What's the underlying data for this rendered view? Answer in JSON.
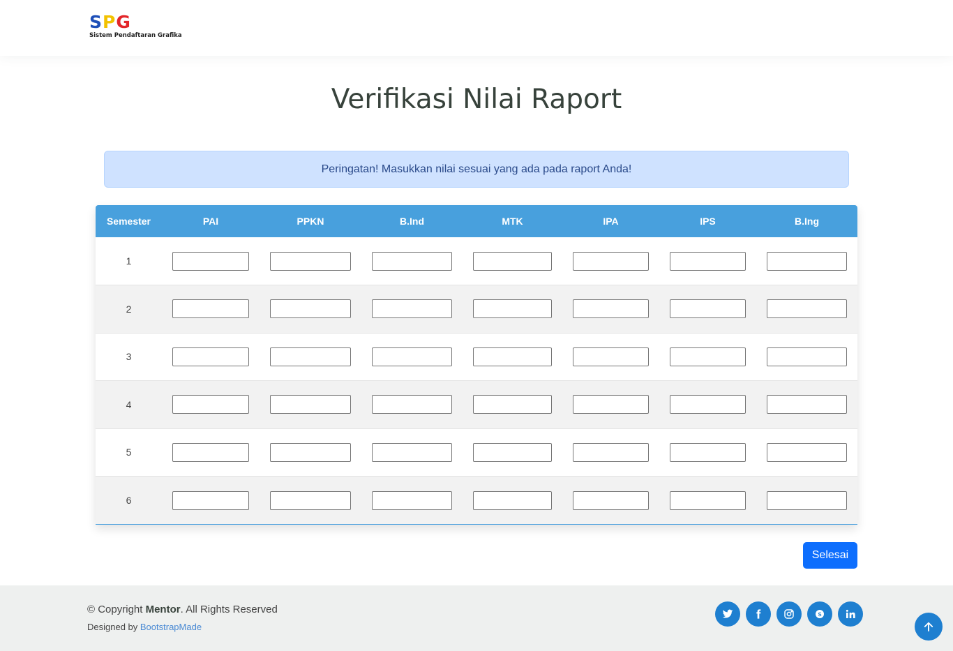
{
  "header": {
    "logo_letters": [
      "S",
      "P",
      "G"
    ],
    "logo_subtitle": "Sistem Pendaftaran Grafika"
  },
  "page": {
    "title": "Verifikasi Nilai Raport"
  },
  "alert": {
    "text": "Peringatan! Masukkan nilai sesuai yang ada pada raport Anda!"
  },
  "table": {
    "columns": [
      "Semester",
      "PAI",
      "PPKN",
      "B.Ind",
      "MTK",
      "IPA",
      "IPS",
      "B.Ing"
    ],
    "rows": [
      {
        "semester": "1",
        "values": [
          "",
          "",
          "",
          "",
          "",
          "",
          ""
        ]
      },
      {
        "semester": "2",
        "values": [
          "",
          "",
          "",
          "",
          "",
          "",
          ""
        ]
      },
      {
        "semester": "3",
        "values": [
          "",
          "",
          "",
          "",
          "",
          "",
          ""
        ]
      },
      {
        "semester": "4",
        "values": [
          "",
          "",
          "",
          "",
          "",
          "",
          ""
        ]
      },
      {
        "semester": "5",
        "values": [
          "",
          "",
          "",
          "",
          "",
          "",
          ""
        ]
      },
      {
        "semester": "6",
        "values": [
          "",
          "",
          "",
          "",
          "",
          "",
          ""
        ]
      }
    ]
  },
  "actions": {
    "submit_label": "Selesai"
  },
  "footer": {
    "copyright_prefix": "© Copyright ",
    "copyright_brand": "Mentor",
    "copyright_suffix": ". All Rights Reserved",
    "designed_by_prefix": "Designed by ",
    "designed_by_link": "BootstrapMade",
    "social_icons": [
      "twitter-icon",
      "facebook-icon",
      "instagram-icon",
      "skype-icon",
      "linkedin-icon"
    ]
  },
  "colors": {
    "primary": "#0d6efd",
    "table_header": "#48a0dd",
    "social": "#1e7fd0",
    "alert_bg": "#cfe2ff",
    "footer_bg": "#eef0ef"
  }
}
